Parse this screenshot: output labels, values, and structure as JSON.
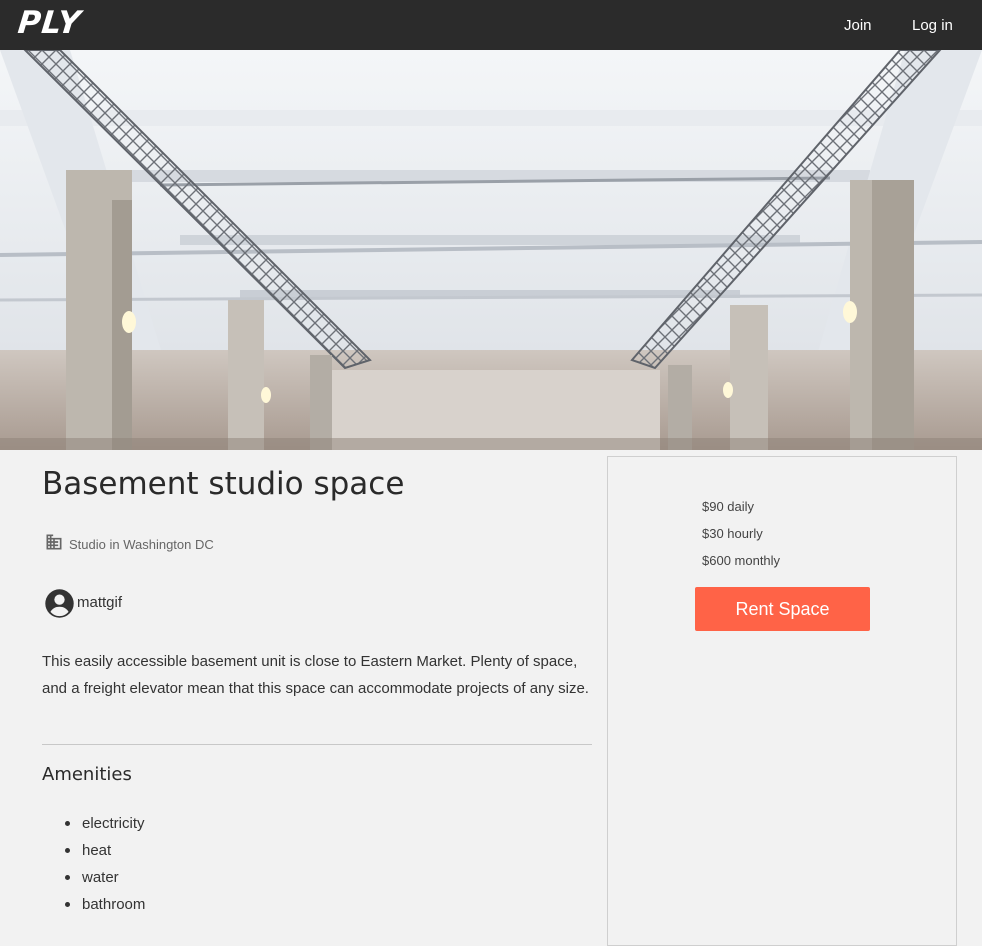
{
  "nav": {
    "logo": "PLY",
    "join": "Join",
    "login": "Log in"
  },
  "listing": {
    "title": "Basement studio space",
    "location": "Studio in Washington DC",
    "location_icon": "building-icon",
    "host": "mattgif",
    "host_icon": "account-circle-icon",
    "description": "This easily accessible basement unit is close to Eastern Market. Plenty of space, and a freight elevator mean that this space can accommodate projects of any size.",
    "amenities_heading": "Amenities",
    "amenities": [
      "electricity",
      "heat",
      "water",
      "bathroom"
    ]
  },
  "pricing": {
    "daily": "$90 daily",
    "hourly": "$30 hourly",
    "monthly": "$600 monthly",
    "button": "Rent Space"
  },
  "colors": {
    "navbar": "#2b2b2b",
    "background": "#f2f2f2",
    "accent": "#ff6347"
  }
}
